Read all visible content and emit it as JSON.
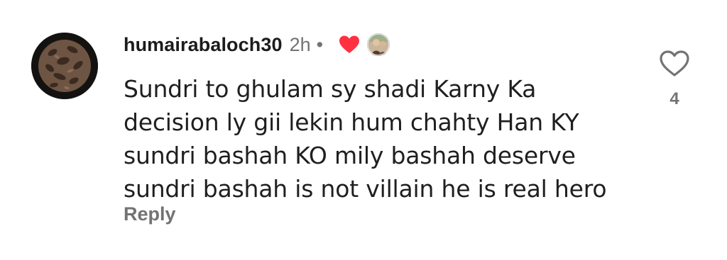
{
  "comment": {
    "username": "humairabaloch30",
    "time": "2h",
    "separator": "•",
    "text_lines": [
      "Sundri to ghulam sy shadi Karny Ka",
      "decision ly gii lekin hum chahty Han KY",
      "sundri bashah KO mily bashah deserve",
      "sundri bashah is not villain he is real hero"
    ],
    "reply_label": "Reply",
    "like_count": "4",
    "icons": {
      "avatar": "user-avatar",
      "author_liked": "red-heart-icon",
      "liker_avatar": "liker-avatar",
      "like": "heart-outline-icon"
    },
    "colors": {
      "heart_red": "#ff3040",
      "secondary_text": "#737373",
      "primary_text": "#1c1c1c"
    }
  }
}
